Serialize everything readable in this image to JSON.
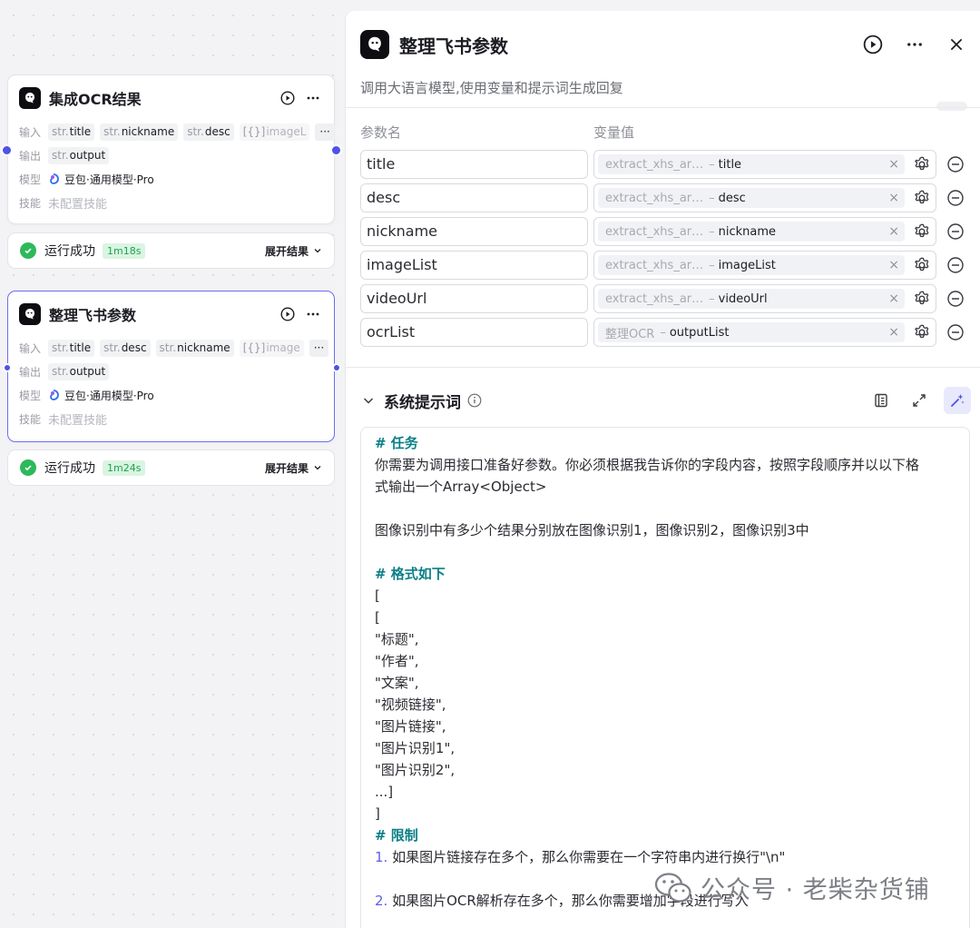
{
  "nodes": [
    {
      "title": "集成OCR结果",
      "input_label": "输入",
      "inputs": [
        {
          "type": "str.",
          "name": "title"
        },
        {
          "type": "str.",
          "name": "nickname"
        },
        {
          "type": "str.",
          "name": "desc"
        },
        {
          "type": "[{}]",
          "name": "imageL"
        }
      ],
      "more": "···",
      "output_label": "输出",
      "output": {
        "type": "str.",
        "name": "output"
      },
      "model_label": "模型",
      "model": "豆包·通用模型·Pro",
      "skill_label": "技能",
      "skill": "未配置技能",
      "status": "运行成功",
      "duration": "1m18s",
      "expand": "展开结果"
    },
    {
      "title": "整理飞书参数",
      "input_label": "输入",
      "inputs": [
        {
          "type": "str.",
          "name": "title"
        },
        {
          "type": "str.",
          "name": "desc"
        },
        {
          "type": "str.",
          "name": "nickname"
        },
        {
          "type": "[{}]",
          "name": "image"
        }
      ],
      "more": "···",
      "output_label": "输出",
      "output": {
        "type": "str.",
        "name": "output"
      },
      "model_label": "模型",
      "model": "豆包·通用模型·Pro",
      "skill_label": "技能",
      "skill": "未配置技能",
      "status": "运行成功",
      "duration": "1m24s",
      "expand": "展开结果"
    }
  ],
  "panel": {
    "title": "整理飞书参数",
    "subtitle": "调用大语言模型,使用变量和提示词生成回复",
    "col_param": "参数名",
    "col_value": "变量值",
    "params": [
      {
        "name": "title",
        "source": "extract_xhs_ar…",
        "field": "title"
      },
      {
        "name": "desc",
        "source": "extract_xhs_ar…",
        "field": "desc"
      },
      {
        "name": "nickname",
        "source": "extract_xhs_ar…",
        "field": "nickname"
      },
      {
        "name": "imageList",
        "source": "extract_xhs_ar…",
        "field": "imageList"
      },
      {
        "name": "videoUrl",
        "source": "extract_xhs_ar…",
        "field": "videoUrl"
      },
      {
        "name": "ocrList",
        "source": "整理OCR",
        "field": "outputList"
      }
    ],
    "value_sep": "–",
    "clear": "×",
    "system_prompt_title": "系统提示词",
    "prompt": {
      "h_task": "# 任务",
      "task_l1": "你需要为调用接口准备好参数。你必须根据我告诉你的字段内容，按照字段顺序并以以下格",
      "task_l2": "式输出一个Array<Object>",
      "task_l3": "图像识别中有多少个结果分别放在图像识别1，图像识别2，图像识别3中",
      "h_format": "# 格式如下",
      "f1": "[",
      "f2": "[",
      "f3": "\"标题\",",
      "f4": "\"作者\",",
      "f5": "\"文案\",",
      "f6": "\"视频链接\",",
      "f7": "\"图片链接\",",
      "f8": "\"图片识别1\",",
      "f9": "\"图片识别2\",",
      "f10": "...]",
      "f11": "]",
      "h_limit": "# 限制",
      "r1_num": "1.",
      "r1": " 如果图片链接存在多个，那么你需要在一个字符串内进行换行\"\\n\"",
      "r2_num": "2.",
      "r2": " 如果图片OCR解析存在多个，那么你需要增加字段进行写入"
    }
  },
  "watermark": "公众号 · 老柴杂货铺",
  "colors": {
    "accent": "#4e52e6",
    "success": "#2eb85c",
    "heading": "#0a7f86",
    "selected_border": "#6c6ef2"
  }
}
